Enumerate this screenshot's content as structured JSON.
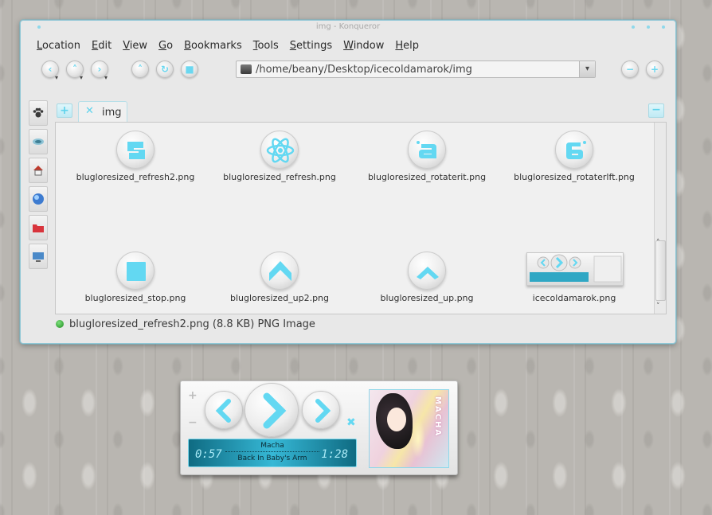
{
  "window": {
    "title": "img - Konqueror"
  },
  "menubar": {
    "items": [
      {
        "accel": "L",
        "rest": "ocation"
      },
      {
        "accel": "E",
        "rest": "dit"
      },
      {
        "accel": "V",
        "rest": "iew"
      },
      {
        "accel": "G",
        "rest": "o"
      },
      {
        "accel": "B",
        "rest": "ookmarks"
      },
      {
        "accel": "T",
        "rest": "ools"
      },
      {
        "accel": "S",
        "rest": "ettings"
      },
      {
        "accel": "W",
        "rest": "indow"
      },
      {
        "accel": "H",
        "rest": "elp"
      }
    ]
  },
  "toolbar": {
    "url": "/home/beany/Desktop/icecoldamarok/img",
    "icons": [
      "back-icon",
      "up-icon",
      "forward-icon",
      "home-icon",
      "reload-icon",
      "stop-icon",
      "zoom-out-icon",
      "zoom-in-icon"
    ]
  },
  "sidebar": {
    "items": [
      "paw-icon",
      "network-icon",
      "home-icon",
      "globe-icon",
      "folder-red-icon",
      "desktop-icon"
    ]
  },
  "tabs": [
    {
      "label": "img"
    }
  ],
  "files": [
    {
      "name": "blugloresized_refresh2.png",
      "icon": "refresh2-icon"
    },
    {
      "name": "blugloresized_refresh.png",
      "icon": "atom-icon"
    },
    {
      "name": "blugloresized_rotaterit.png",
      "icon": "rotate-right-icon"
    },
    {
      "name": "blugloresized_rotaterlft.png",
      "icon": "rotate-left-icon"
    },
    {
      "name": "blugloresized_stop.png",
      "icon": "stop-icon"
    },
    {
      "name": "blugloresized_up2.png",
      "icon": "up2-icon"
    },
    {
      "name": "blugloresized_up.png",
      "icon": "up-icon"
    },
    {
      "name": "icecoldamarok.png",
      "icon": "thumbnail-icon"
    }
  ],
  "status": {
    "text": "blugloresized_refresh2.png (8.8 KB)  PNG Image"
  },
  "player": {
    "artist": "Macha",
    "track": "Back In Baby's Arm",
    "elapsed": "0:57",
    "remaining": "1:28",
    "cover_text": "MACHA"
  },
  "colors": {
    "accent": "#5fd3ec",
    "window_border": "#8fc7d6"
  }
}
